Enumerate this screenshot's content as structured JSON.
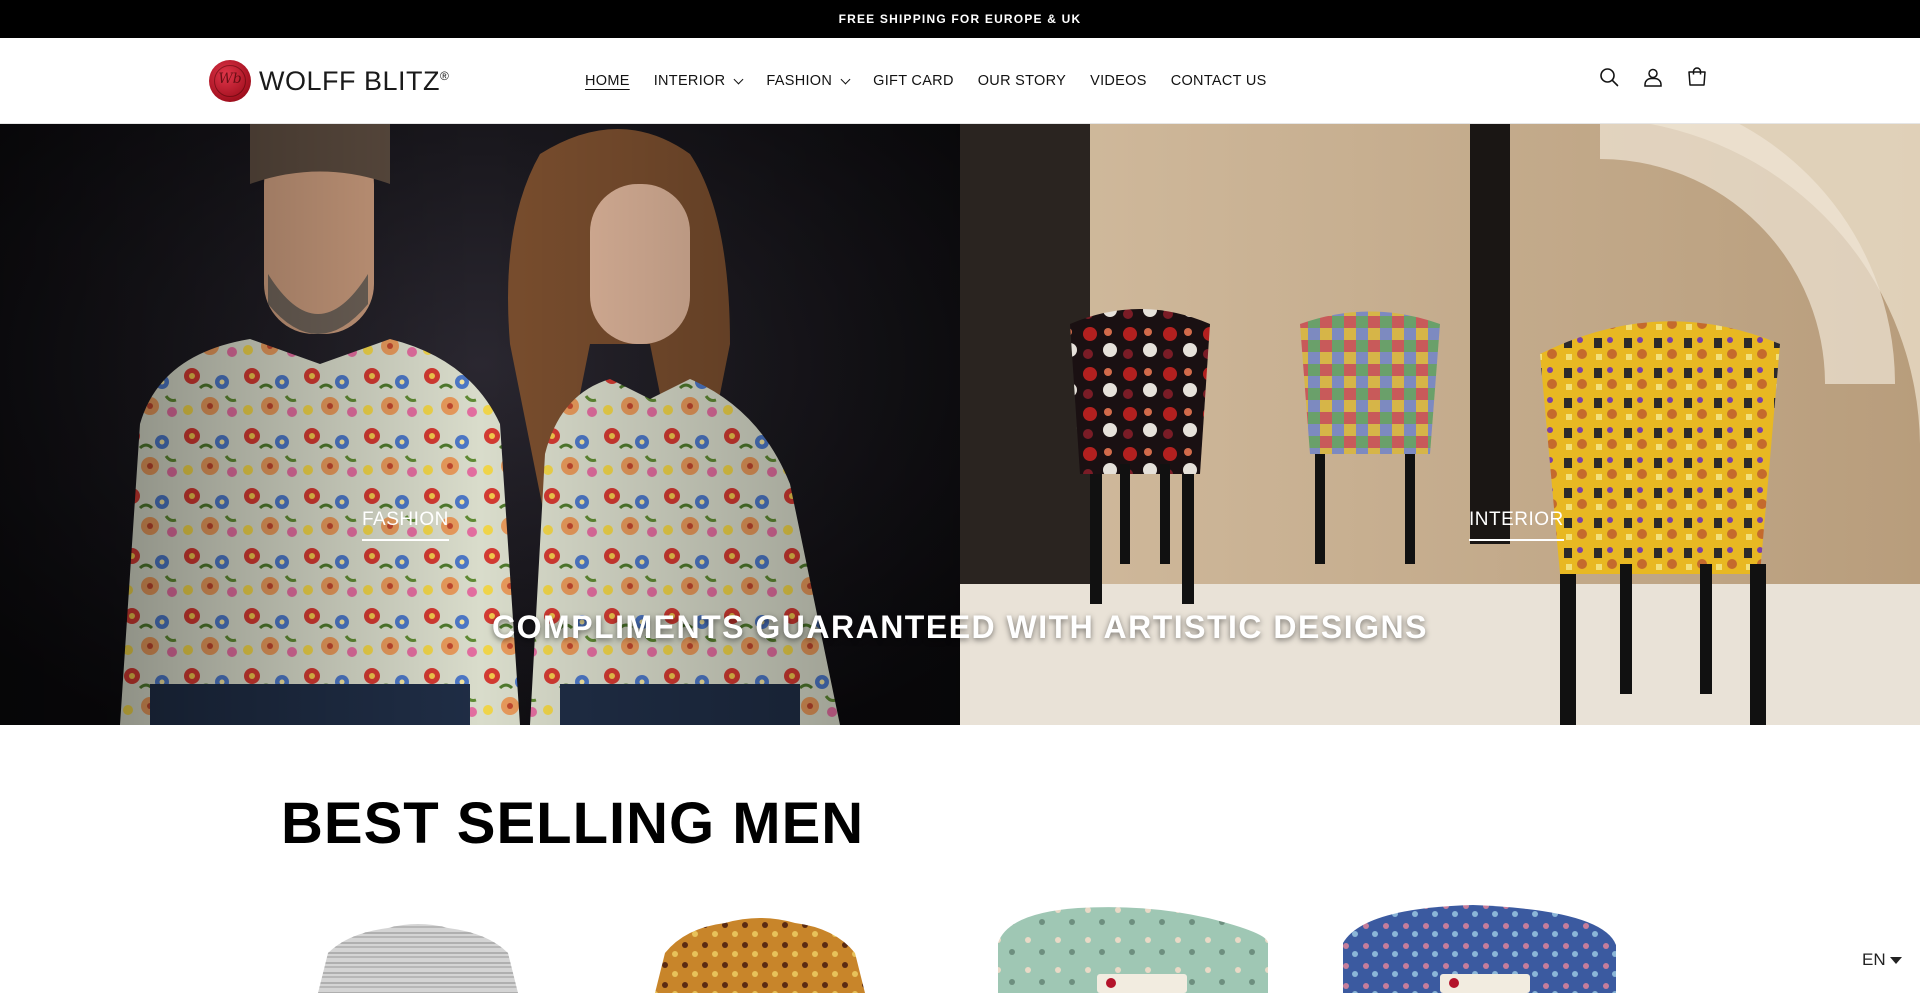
{
  "announcement": {
    "text": "FREE SHIPPING FOR EUROPE & UK"
  },
  "brand": {
    "name": "WOLFF BLITZ",
    "mark": "®"
  },
  "nav": {
    "items": [
      {
        "label": "HOME",
        "active": true,
        "dropdown": false
      },
      {
        "label": "INTERIOR",
        "active": false,
        "dropdown": true
      },
      {
        "label": "FASHION",
        "active": false,
        "dropdown": true
      },
      {
        "label": "GIFT CARD",
        "active": false,
        "dropdown": false
      },
      {
        "label": "OUR STORY",
        "active": false,
        "dropdown": false
      },
      {
        "label": "VIDEOS",
        "active": false,
        "dropdown": false
      },
      {
        "label": "CONTACT US",
        "active": false,
        "dropdown": false
      }
    ]
  },
  "header_icons": [
    "search-icon",
    "account-icon",
    "cart-icon"
  ],
  "hero": {
    "left_link": "FASHION",
    "right_link": "INTERIOR",
    "caption": "COMPLIMENTS GUARANTEED WITH ARTISTIC DESIGNS"
  },
  "best_selling": {
    "title": "BEST SELLING MEN"
  },
  "language": {
    "current": "EN"
  },
  "colors": {
    "announcement_bg": "#000000",
    "brand_red": "#b3132a",
    "text": "#121212"
  }
}
